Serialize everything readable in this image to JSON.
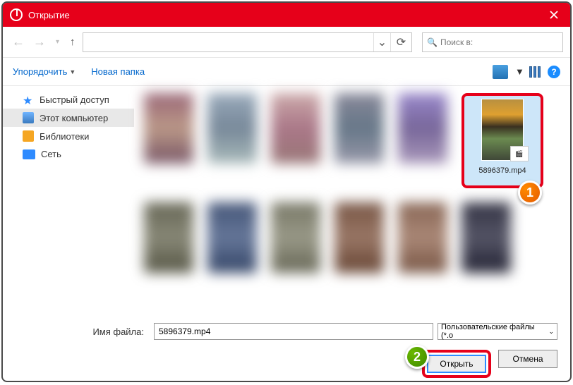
{
  "window": {
    "title": "Открытие"
  },
  "nav": {
    "search_placeholder": "Поиск в:"
  },
  "toolbar": {
    "organize": "Упорядочить",
    "new_folder": "Новая папка",
    "help": "?"
  },
  "sidebar": {
    "items": [
      {
        "label": "Быстрый доступ"
      },
      {
        "label": "Этот компьютер"
      },
      {
        "label": "Библиотеки"
      },
      {
        "label": "Сеть"
      }
    ]
  },
  "selected": {
    "name": "5896379.mp4"
  },
  "footer": {
    "filename_label": "Имя файла:",
    "filename_value": "5896379.mp4",
    "filter_label": "Пользовательские файлы (*.o",
    "open": "Открыть",
    "cancel": "Отмена"
  },
  "markers": {
    "one": "1",
    "two": "2"
  }
}
